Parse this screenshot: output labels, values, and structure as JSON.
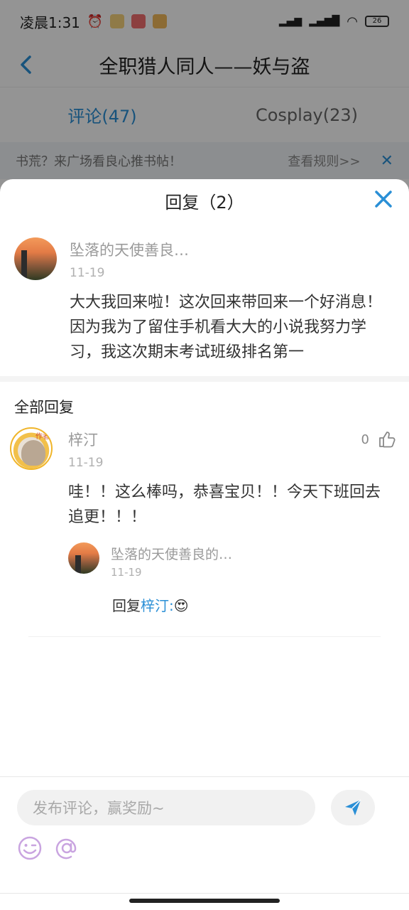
{
  "status_bar": {
    "time": "凌晨1:31",
    "battery": "26"
  },
  "nav": {
    "title": "全职猎人同人——妖与盗"
  },
  "tabs": [
    {
      "label": "评论(47)"
    },
    {
      "label": "Cosplay(23)"
    }
  ],
  "notice": {
    "text": "书荒？来广场看良心推书帖！",
    "rule_link": "查看规则>>"
  },
  "sheet": {
    "title": "回复（2）",
    "main_comment": {
      "name": "坠落的天使善良…",
      "time": "11-19",
      "text": "大大我回来啦！这次回来带回来一个好消息！因为我为了留住手机看大大的小说我努力学习，我这次期末考试班级排名第一"
    },
    "section_title": "全部回复",
    "reply": {
      "name": "梓汀",
      "time": "11-19",
      "like_count": "0",
      "author_badge": "作者",
      "text": "哇！！这么棒吗，恭喜宝贝！！今天下班回去追更！！！"
    },
    "sub_reply": {
      "name": "坠落的天使善良的…",
      "time": "11-19",
      "prefix": "回复",
      "target": "梓汀:",
      "emoji": "😍"
    }
  },
  "input": {
    "placeholder": "发布评论，赢奖励~"
  },
  "colors": {
    "accent": "#2a8fd6",
    "tool_icon": "#c9a4e0"
  }
}
